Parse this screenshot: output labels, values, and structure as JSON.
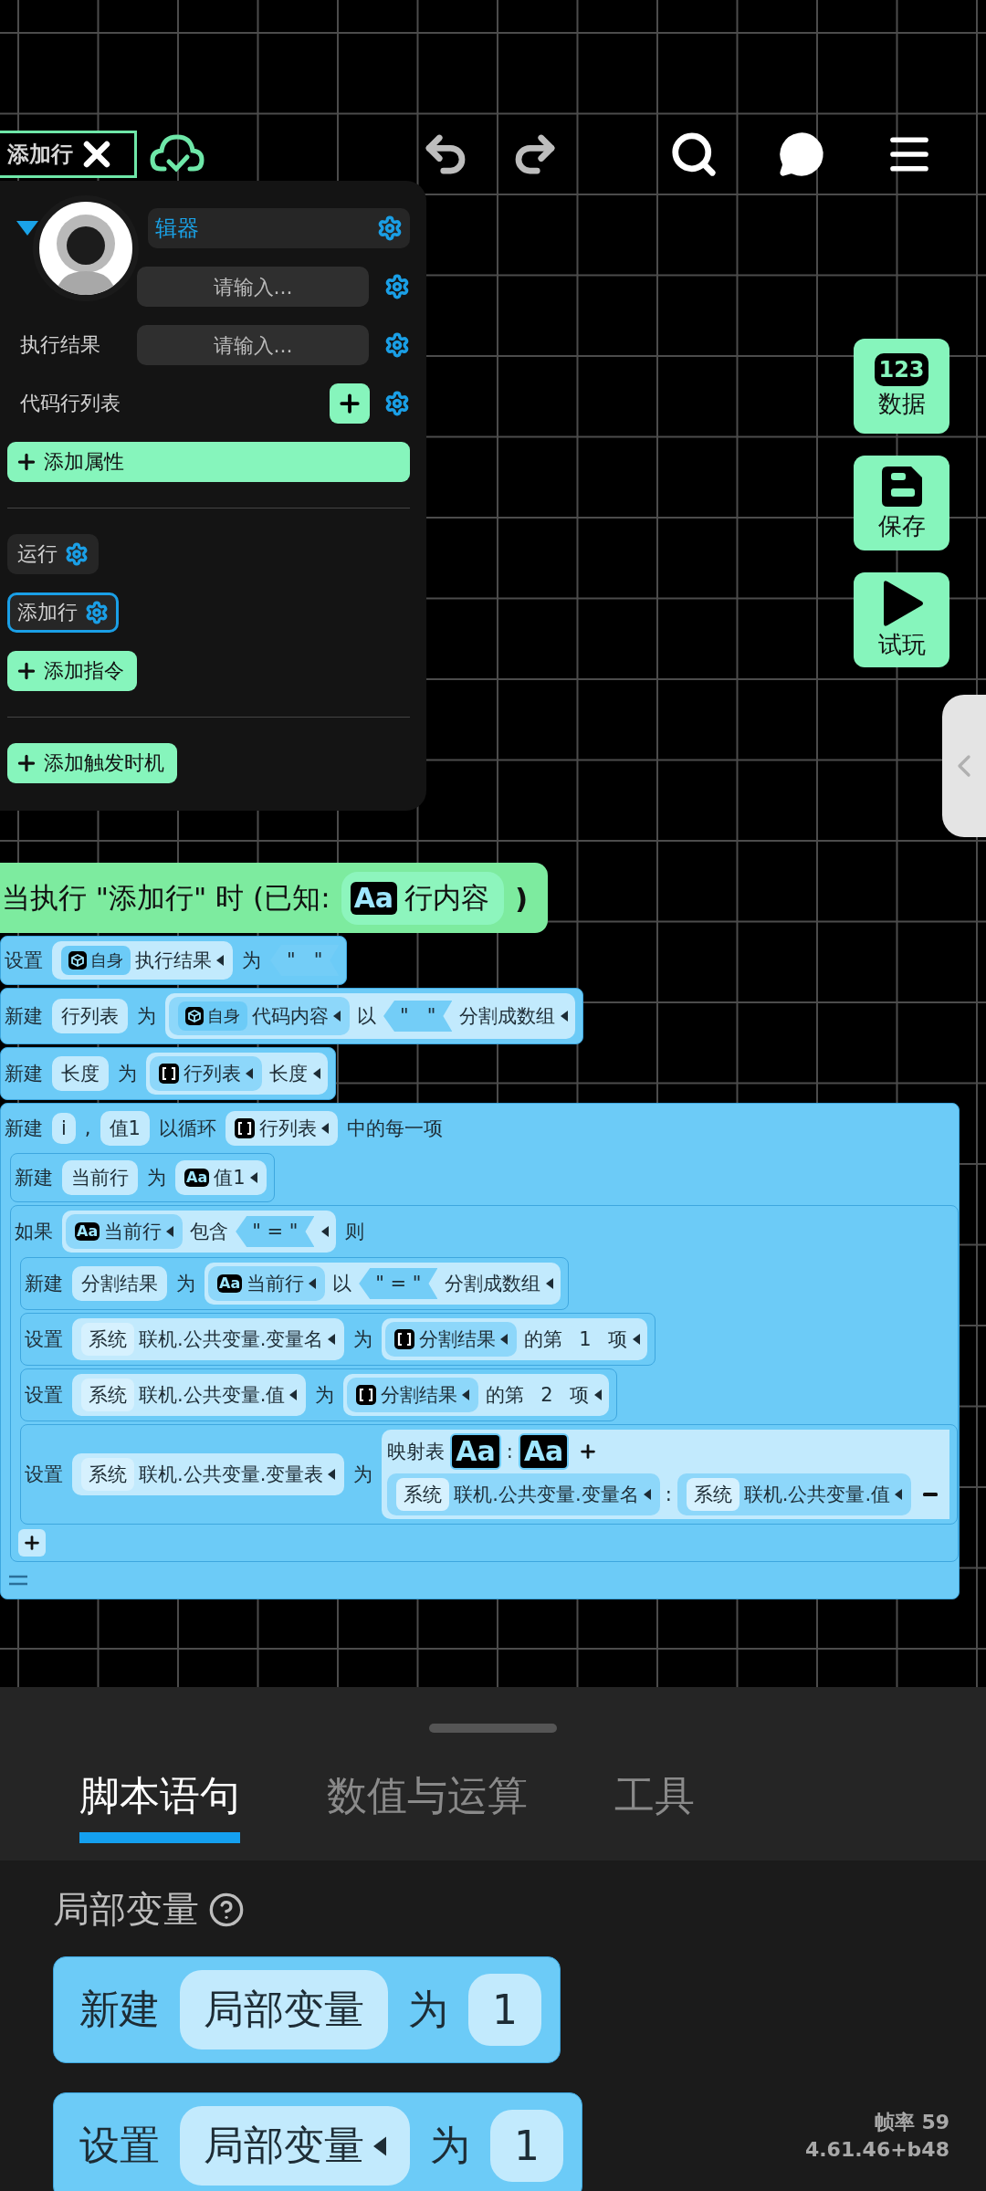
{
  "top_bar": {
    "node_label": "添加行",
    "actions": [
      {
        "kind": "undo",
        "disabled": true
      },
      {
        "kind": "redo",
        "disabled": true
      },
      {
        "kind": "search",
        "disabled": false
      },
      {
        "kind": "chat",
        "disabled": false
      },
      {
        "kind": "menu",
        "disabled": false
      }
    ]
  },
  "panel": {
    "header": "辑器",
    "fields": [
      {
        "kind": "input",
        "placeholder": "请输入..."
      },
      {
        "kind": "input",
        "label": "执行结果",
        "placeholder": "请输入..."
      },
      {
        "kind": "list",
        "label": "代码行列表"
      }
    ],
    "add_property": "添加属性",
    "commands": [
      {
        "label": "运行",
        "selected": false
      },
      {
        "label": "添加行",
        "selected": true
      }
    ],
    "add_command": "添加指令",
    "add_trigger": "添加触发时机"
  },
  "side_buttons": [
    {
      "kind": "data",
      "badge": "123",
      "label": "数据"
    },
    {
      "kind": "save",
      "label": "保存"
    },
    {
      "kind": "play",
      "label": "试玩"
    }
  ],
  "script": {
    "event": {
      "text": "当执行 \"添加行\" 时 (已知:",
      "param": {
        "badge": "Aa",
        "name": "行内容"
      },
      "close": ")"
    },
    "statements": [
      {
        "kind": "simple",
        "items": [
          {
            "kind": "word",
            "text": "设置"
          },
          {
            "kind": "ref",
            "scope": {
              "kind": "self",
              "text": "自身"
            },
            "name": "执行结果",
            "dropdown": true
          },
          {
            "kind": "word",
            "text": "为"
          },
          {
            "kind": "str",
            "text": "\"   \""
          }
        ]
      },
      {
        "kind": "simple",
        "items": [
          {
            "kind": "word",
            "text": "新建"
          },
          {
            "kind": "field",
            "text": "行列表"
          },
          {
            "kind": "word",
            "text": "为"
          },
          {
            "kind": "expr",
            "items": [
              {
                "kind": "ref",
                "scope": {
                  "kind": "self",
                  "text": "自身"
                },
                "name": "代码内容",
                "dropdown": true
              },
              {
                "kind": "word",
                "text": "以"
              },
              {
                "kind": "str",
                "text": "\"   \""
              },
              {
                "kind": "word",
                "text": "分割成数组",
                "dropdown": true
              }
            ]
          }
        ]
      },
      {
        "kind": "simple",
        "items": [
          {
            "kind": "word",
            "text": "新建"
          },
          {
            "kind": "field",
            "text": "长度"
          },
          {
            "kind": "word",
            "text": "为"
          },
          {
            "kind": "expr",
            "items": [
              {
                "kind": "ref",
                "badge": {
                  "kind": "list"
                },
                "name": "行列表",
                "dropdown": true
              },
              {
                "kind": "word",
                "text": "长度",
                "dropdown": true
              }
            ]
          }
        ]
      },
      {
        "kind": "loop",
        "items": [
          {
            "kind": "word",
            "text": "新建"
          },
          {
            "kind": "field",
            "text": "i"
          },
          {
            "kind": "word",
            "text": ","
          },
          {
            "kind": "field",
            "text": "值1"
          },
          {
            "kind": "word",
            "text": "以循环"
          },
          {
            "kind": "ref",
            "badge": {
              "kind": "list"
            },
            "name": "行列表",
            "dropdown": true
          },
          {
            "kind": "word",
            "text": "中的每一项"
          }
        ],
        "children": [
          {
            "kind": "simple",
            "items": [
              {
                "kind": "word",
                "text": "新建"
              },
              {
                "kind": "field",
                "text": "当前行"
              },
              {
                "kind": "word",
                "text": "为"
              },
              {
                "kind": "ref",
                "badge": {
                  "kind": "text",
                  "label": "Aa"
                },
                "name": "值1",
                "dropdown": true
              }
            ]
          },
          {
            "kind": "if",
            "items": [
              {
                "kind": "word",
                "text": "如果"
              },
              {
                "kind": "expr",
                "dropdown": true,
                "items": [
                  {
                    "kind": "ref",
                    "badge": {
                      "kind": "text",
                      "label": "Aa"
                    },
                    "name": "当前行",
                    "dropdown": true
                  },
                  {
                    "kind": "word",
                    "text": "包含"
                  },
                  {
                    "kind": "str",
                    "text": "\" = \""
                  }
                ]
              },
              {
                "kind": "word",
                "text": "则"
              }
            ],
            "children": [
              {
                "kind": "simple",
                "items": [
                  {
                    "kind": "word",
                    "text": "新建"
                  },
                  {
                    "kind": "field",
                    "text": "分割结果"
                  },
                  {
                    "kind": "word",
                    "text": "为"
                  },
                  {
                    "kind": "expr",
                    "items": [
                      {
                        "kind": "ref",
                        "badge": {
                          "kind": "text",
                          "label": "Aa"
                        },
                        "name": "当前行",
                        "dropdown": true
                      },
                      {
                        "kind": "word",
                        "text": "以"
                      },
                      {
                        "kind": "str",
                        "text": "\" = \""
                      },
                      {
                        "kind": "word",
                        "text": "分割成数组",
                        "dropdown": true
                      }
                    ]
                  }
                ]
              },
              {
                "kind": "simple",
                "items": [
                  {
                    "kind": "word",
                    "text": "设置"
                  },
                  {
                    "kind": "ref",
                    "scope": {
                      "kind": "system",
                      "text": "系统"
                    },
                    "name": "联机.公共变量.变量名",
                    "dropdown": true
                  },
                  {
                    "kind": "word",
                    "text": "为"
                  },
                  {
                    "kind": "expr",
                    "items": [
                      {
                        "kind": "ref",
                        "badge": {
                          "kind": "list"
                        },
                        "name": "分割结果",
                        "dropdown": true
                      },
                      {
                        "kind": "word",
                        "text": "的第"
                      },
                      {
                        "kind": "num",
                        "text": "1"
                      },
                      {
                        "kind": "word",
                        "text": "项",
                        "dropdown": true
                      }
                    ]
                  }
                ]
              },
              {
                "kind": "simple",
                "items": [
                  {
                    "kind": "word",
                    "text": "设置"
                  },
                  {
                    "kind": "ref",
                    "scope": {
                      "kind": "system",
                      "text": "系统"
                    },
                    "name": "联机.公共变量.值",
                    "dropdown": true
                  },
                  {
                    "kind": "word",
                    "text": "为"
                  },
                  {
                    "kind": "expr",
                    "items": [
                      {
                        "kind": "ref",
                        "badge": {
                          "kind": "list"
                        },
                        "name": "分割结果",
                        "dropdown": true
                      },
                      {
                        "kind": "word",
                        "text": "的第"
                      },
                      {
                        "kind": "num",
                        "text": "2"
                      },
                      {
                        "kind": "word",
                        "text": "项",
                        "dropdown": true
                      }
                    ]
                  }
                ]
              },
              {
                "kind": "simple",
                "items": [
                  {
                    "kind": "word",
                    "text": "设置"
                  },
                  {
                    "kind": "ref",
                    "scope": {
                      "kind": "system",
                      "text": "系统"
                    },
                    "name": "联机.公共变量.变量表",
                    "dropdown": true
                  },
                  {
                    "kind": "word",
                    "text": "为"
                  },
                  {
                    "kind": "map",
                    "label": "映射表",
                    "key_badge": "Aa",
                    "separator": ":",
                    "value_badge": "Aa",
                    "entries": [
                      {
                        "key": {
                          "kind": "ref",
                          "scope": {
                            "kind": "system",
                            "text": "系统"
                          },
                          "name": "联机.公共变量.变量名",
                          "dropdown": true
                        },
                        "separator": ":",
                        "value": {
                          "kind": "ref",
                          "scope": {
                            "kind": "system",
                            "text": "系统"
                          },
                          "name": "联机.公共变量.值",
                          "dropdown": true
                        }
                      }
                    ]
                  }
                ]
              }
            ]
          }
        ]
      }
    ]
  },
  "palette": {
    "tabs": [
      {
        "label": "脚本语句",
        "selected": true
      },
      {
        "label": "数值与运算",
        "selected": false
      },
      {
        "label": "工具",
        "selected": false
      }
    ],
    "section": "局部变量",
    "blocks": [
      {
        "kind": "simple",
        "items": [
          {
            "kind": "word",
            "text": "新建"
          },
          {
            "kind": "field",
            "text": "局部变量"
          },
          {
            "kind": "word",
            "text": "为"
          },
          {
            "kind": "num",
            "text": "1"
          }
        ]
      },
      {
        "kind": "simple",
        "items": [
          {
            "kind": "word",
            "text": "设置"
          },
          {
            "kind": "ref",
            "name": "局部变量",
            "dropdown": true
          },
          {
            "kind": "word",
            "text": "为"
          },
          {
            "kind": "num",
            "text": "1"
          }
        ]
      }
    ]
  },
  "status": {
    "fps": "帧率 59",
    "version": "4.61.46+b48"
  }
}
